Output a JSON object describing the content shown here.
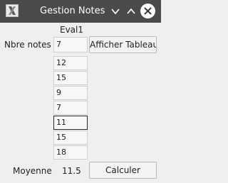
{
  "window": {
    "title": "Gestion Notes",
    "colors": {
      "titlebar": "#4a4a4a",
      "background": "#efefef"
    },
    "controls": {
      "minimize_icon": "chevron-down-icon",
      "maximize_icon": "chevron-up-icon",
      "close_icon": "close-icon"
    }
  },
  "grades": {
    "column_header": "Eval1",
    "label": "Nbre notes :",
    "count_value": "7",
    "values": [
      "12",
      "15",
      "9",
      "7",
      "11",
      "15",
      "18"
    ]
  },
  "actions": {
    "show_table_label": "Afficher Tableau",
    "compute_label": "Calculer"
  },
  "result": {
    "label": "Moyenne",
    "value": "11.5"
  }
}
